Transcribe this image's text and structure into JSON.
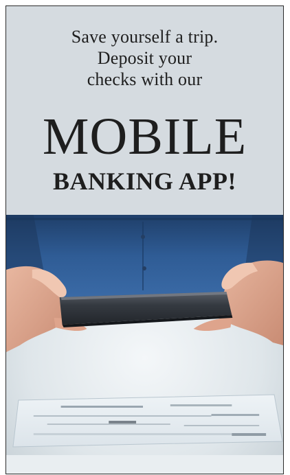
{
  "ad": {
    "intro_lines": [
      "Save yourself a trip.",
      "Deposit your",
      "checks with our"
    ],
    "headline": "MOBILE",
    "subheadline": "BANKING APP!",
    "colors": {
      "panel_background": "#d5dbe0",
      "text": "#1e1e1e",
      "shirt": "#2f5c95",
      "phone": "#3a3f46"
    },
    "photo_icon": "hands-holding-phone-over-check"
  }
}
